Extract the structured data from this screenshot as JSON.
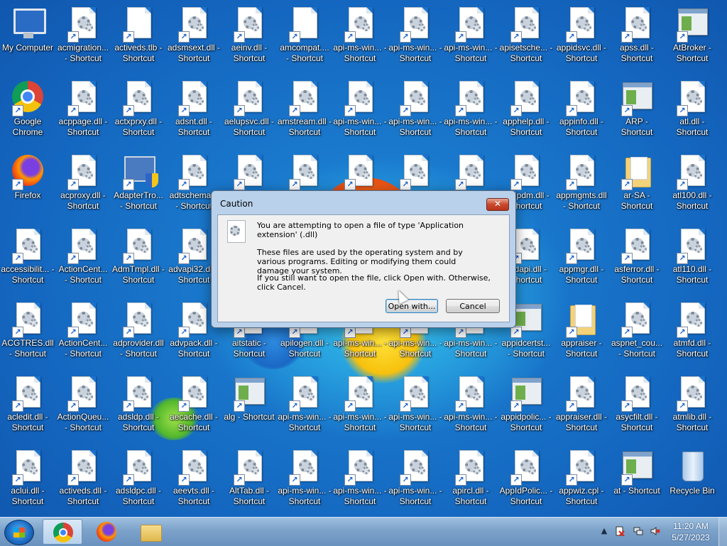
{
  "desktop": {
    "icons": [
      {
        "label": "My Computer",
        "type": "computer",
        "col": 0,
        "row": 0
      },
      {
        "label": "acmigration... - Shortcut",
        "type": "dll",
        "col": 1,
        "row": 0
      },
      {
        "label": "activeds.tlb - Shortcut",
        "type": "blank",
        "col": 2,
        "row": 0
      },
      {
        "label": "adsmsext.dll - Shortcut",
        "type": "dll",
        "col": 3,
        "row": 0
      },
      {
        "label": "aeinv.dll - Shortcut",
        "type": "dll",
        "col": 4,
        "row": 0
      },
      {
        "label": "amcompat.... - Shortcut",
        "type": "blank",
        "col": 5,
        "row": 0
      },
      {
        "label": "api-ms-win... - Shortcut",
        "type": "dll",
        "col": 6,
        "row": 0
      },
      {
        "label": "api-ms-win... - Shortcut",
        "type": "dll",
        "col": 7,
        "row": 0
      },
      {
        "label": "api-ms-win... - Shortcut",
        "type": "dll",
        "col": 8,
        "row": 0
      },
      {
        "label": "apisetsche... - Shortcut",
        "type": "dll",
        "col": 9,
        "row": 0
      },
      {
        "label": "appidsvc.dll - Shortcut",
        "type": "dll",
        "col": 10,
        "row": 0
      },
      {
        "label": "apss.dll - Shortcut",
        "type": "dll",
        "col": 11,
        "row": 0
      },
      {
        "label": "AtBroker - Shortcut",
        "type": "app",
        "col": 12,
        "row": 0
      },
      {
        "label": "Google Chrome",
        "type": "chrome",
        "col": 0,
        "row": 1
      },
      {
        "label": "acppage.dll - Shortcut",
        "type": "dll",
        "col": 1,
        "row": 1
      },
      {
        "label": "actxprxy.dll - Shortcut",
        "type": "dll",
        "col": 2,
        "row": 1
      },
      {
        "label": "adsnt.dll - Shortcut",
        "type": "dll",
        "col": 3,
        "row": 1
      },
      {
        "label": "aelupsvc.dll - Shortcut",
        "type": "dll",
        "col": 4,
        "row": 1
      },
      {
        "label": "amstream.dll - Shortcut",
        "type": "dll",
        "col": 5,
        "row": 1
      },
      {
        "label": "api-ms-win... - Shortcut",
        "type": "dll",
        "col": 6,
        "row": 1
      },
      {
        "label": "api-ms-win... - Shortcut",
        "type": "dll",
        "col": 7,
        "row": 1
      },
      {
        "label": "api-ms-win... - Shortcut",
        "type": "dll",
        "col": 8,
        "row": 1
      },
      {
        "label": "apphelp.dll - Shortcut",
        "type": "dll",
        "col": 9,
        "row": 1
      },
      {
        "label": "appinfo.dll - Shortcut",
        "type": "dll",
        "col": 10,
        "row": 1
      },
      {
        "label": "ARP - Shortcut",
        "type": "app",
        "col": 11,
        "row": 1
      },
      {
        "label": "atl.dll - Shortcut",
        "type": "dll",
        "col": 12,
        "row": 1
      },
      {
        "label": "Firefox",
        "type": "firefox",
        "col": 0,
        "row": 2
      },
      {
        "label": "acproxy.dll - Shortcut",
        "type": "dll",
        "col": 1,
        "row": 2
      },
      {
        "label": "AdapterTro... - Shortcut",
        "type": "shield",
        "col": 2,
        "row": 2
      },
      {
        "label": "adtschema... - Shortcut",
        "type": "dll",
        "col": 3,
        "row": 2
      },
      {
        "label": "",
        "type": "dll",
        "col": 4,
        "row": 2
      },
      {
        "label": "",
        "type": "dll",
        "col": 5,
        "row": 2
      },
      {
        "label": "",
        "type": "dll",
        "col": 6,
        "row": 2
      },
      {
        "label": "",
        "type": "dll",
        "col": 7,
        "row": 2
      },
      {
        "label": "",
        "type": "dll",
        "col": 8,
        "row": 2
      },
      {
        "label": "...hlpdm.dll - Shortcut",
        "type": "dll",
        "col": 9,
        "row": 2
      },
      {
        "label": "appmgmts.dll - Shortcut",
        "type": "dll",
        "col": 10,
        "row": 2
      },
      {
        "label": "ar-SA - Shortcut",
        "type": "folder",
        "col": 11,
        "row": 2
      },
      {
        "label": "atl100.dll - Shortcut",
        "type": "dll",
        "col": 12,
        "row": 2
      },
      {
        "label": "accessibilit... - Shortcut",
        "type": "dll",
        "col": 0,
        "row": 3
      },
      {
        "label": "ActionCent... - Shortcut",
        "type": "dll",
        "col": 1,
        "row": 3
      },
      {
        "label": "AdmTmpl.dll - Shortcut",
        "type": "dll",
        "col": 2,
        "row": 3
      },
      {
        "label": "advapi32.dll - Shortcut",
        "type": "dll",
        "col": 3,
        "row": 3
      },
      {
        "label": "...idapi.dll - Shortcut",
        "type": "dll",
        "col": 9,
        "row": 3
      },
      {
        "label": "appmgr.dll - Shortcut",
        "type": "dll",
        "col": 10,
        "row": 3
      },
      {
        "label": "asferror.dll - Shortcut",
        "type": "dll",
        "col": 11,
        "row": 3
      },
      {
        "label": "atl110.dll - Shortcut",
        "type": "dll",
        "col": 12,
        "row": 3
      },
      {
        "label": "ACGTRES.dll - Shortcut",
        "type": "dll",
        "col": 0,
        "row": 4
      },
      {
        "label": "ActionCent... - Shortcut",
        "type": "dll",
        "col": 1,
        "row": 4
      },
      {
        "label": "adprovider.dll - Shortcut",
        "type": "dll",
        "col": 2,
        "row": 4
      },
      {
        "label": "advpack.dll - Shortcut",
        "type": "dll",
        "col": 3,
        "row": 4
      },
      {
        "label": "aitstatic - Shortcut",
        "type": "blank",
        "col": 4,
        "row": 4
      },
      {
        "label": "apilogen.dll - Shortcut",
        "type": "dll",
        "col": 5,
        "row": 4
      },
      {
        "label": "api-ms-win... - Shortcut",
        "type": "dll",
        "col": 6,
        "row": 4
      },
      {
        "label": "api-ms-win... - Shortcut",
        "type": "dll",
        "col": 7,
        "row": 4
      },
      {
        "label": "api-ms-win... - Shortcut",
        "type": "dll",
        "col": 8,
        "row": 4
      },
      {
        "label": "appidcertst... - Shortcut",
        "type": "app",
        "col": 9,
        "row": 4
      },
      {
        "label": "appraiser - Shortcut",
        "type": "folder",
        "col": 10,
        "row": 4
      },
      {
        "label": "aspnet_cou... - Shortcut",
        "type": "dll",
        "col": 11,
        "row": 4
      },
      {
        "label": "atmfd.dll - Shortcut",
        "type": "dll",
        "col": 12,
        "row": 4
      },
      {
        "label": "acledit.dll - Shortcut",
        "type": "dll",
        "col": 0,
        "row": 5
      },
      {
        "label": "ActionQueu... - Shortcut",
        "type": "dll",
        "col": 1,
        "row": 5
      },
      {
        "label": "adsldp.dll - Shortcut",
        "type": "dll",
        "col": 2,
        "row": 5
      },
      {
        "label": "aecache.dll - Shortcut",
        "type": "dll",
        "col": 3,
        "row": 5
      },
      {
        "label": "alg - Shortcut",
        "type": "app",
        "col": 4,
        "row": 5
      },
      {
        "label": "api-ms-win... - Shortcut",
        "type": "dll",
        "col": 5,
        "row": 5
      },
      {
        "label": "api-ms-win... - Shortcut",
        "type": "dll",
        "col": 6,
        "row": 5
      },
      {
        "label": "api-ms-win... - Shortcut",
        "type": "dll",
        "col": 7,
        "row": 5
      },
      {
        "label": "api-ms-win... - Shortcut",
        "type": "dll",
        "col": 8,
        "row": 5
      },
      {
        "label": "appidpolic... - Shortcut",
        "type": "app",
        "col": 9,
        "row": 5
      },
      {
        "label": "appraiser.dll - Shortcut",
        "type": "dll",
        "col": 10,
        "row": 5
      },
      {
        "label": "asycfilt.dll - Shortcut",
        "type": "dll",
        "col": 11,
        "row": 5
      },
      {
        "label": "atmlib.dll - Shortcut",
        "type": "dll",
        "col": 12,
        "row": 5
      },
      {
        "label": "aclui.dll - Shortcut",
        "type": "dll",
        "col": 0,
        "row": 6
      },
      {
        "label": "activeds.dll - Shortcut",
        "type": "dll",
        "col": 1,
        "row": 6
      },
      {
        "label": "adsldpc.dll - Shortcut",
        "type": "dll",
        "col": 2,
        "row": 6
      },
      {
        "label": "aeevts.dll - Shortcut",
        "type": "dll",
        "col": 3,
        "row": 6
      },
      {
        "label": "AltTab.dll - Shortcut",
        "type": "dll",
        "col": 4,
        "row": 6
      },
      {
        "label": "api-ms-win... - Shortcut",
        "type": "dll",
        "col": 5,
        "row": 6
      },
      {
        "label": "api-ms-win... - Shortcut",
        "type": "dll",
        "col": 6,
        "row": 6
      },
      {
        "label": "api-ms-win... - Shortcut",
        "type": "dll",
        "col": 7,
        "row": 6
      },
      {
        "label": "apircl.dll - Shortcut",
        "type": "dll",
        "col": 8,
        "row": 6
      },
      {
        "label": "AppIdPolic... - Shortcut",
        "type": "dll",
        "col": 9,
        "row": 6
      },
      {
        "label": "appwiz.cpl - Shortcut",
        "type": "dll",
        "col": 10,
        "row": 6
      },
      {
        "label": "at - Shortcut",
        "type": "app",
        "col": 11,
        "row": 6
      },
      {
        "label": "Recycle Bin",
        "type": "bin",
        "col": 12,
        "row": 6
      }
    ]
  },
  "dialog": {
    "title": "Caution",
    "line1": "You are attempting to open a file of type 'Application extension' (.dll)",
    "line2": "These files are used by the operating system and by various programs. Editing or modifying them could damage your system.",
    "line3": "If you still want to open the file, click Open with. Otherwise, click Cancel.",
    "open_with_label": "Open with...",
    "cancel_label": "Cancel",
    "close_glyph": "✕"
  },
  "taskbar": {
    "apps": [
      "Google Chrome",
      "Firefox",
      "Windows Explorer"
    ],
    "tray_arrow": "▲",
    "time": "11:20 AM",
    "date": "5/27/2023"
  }
}
